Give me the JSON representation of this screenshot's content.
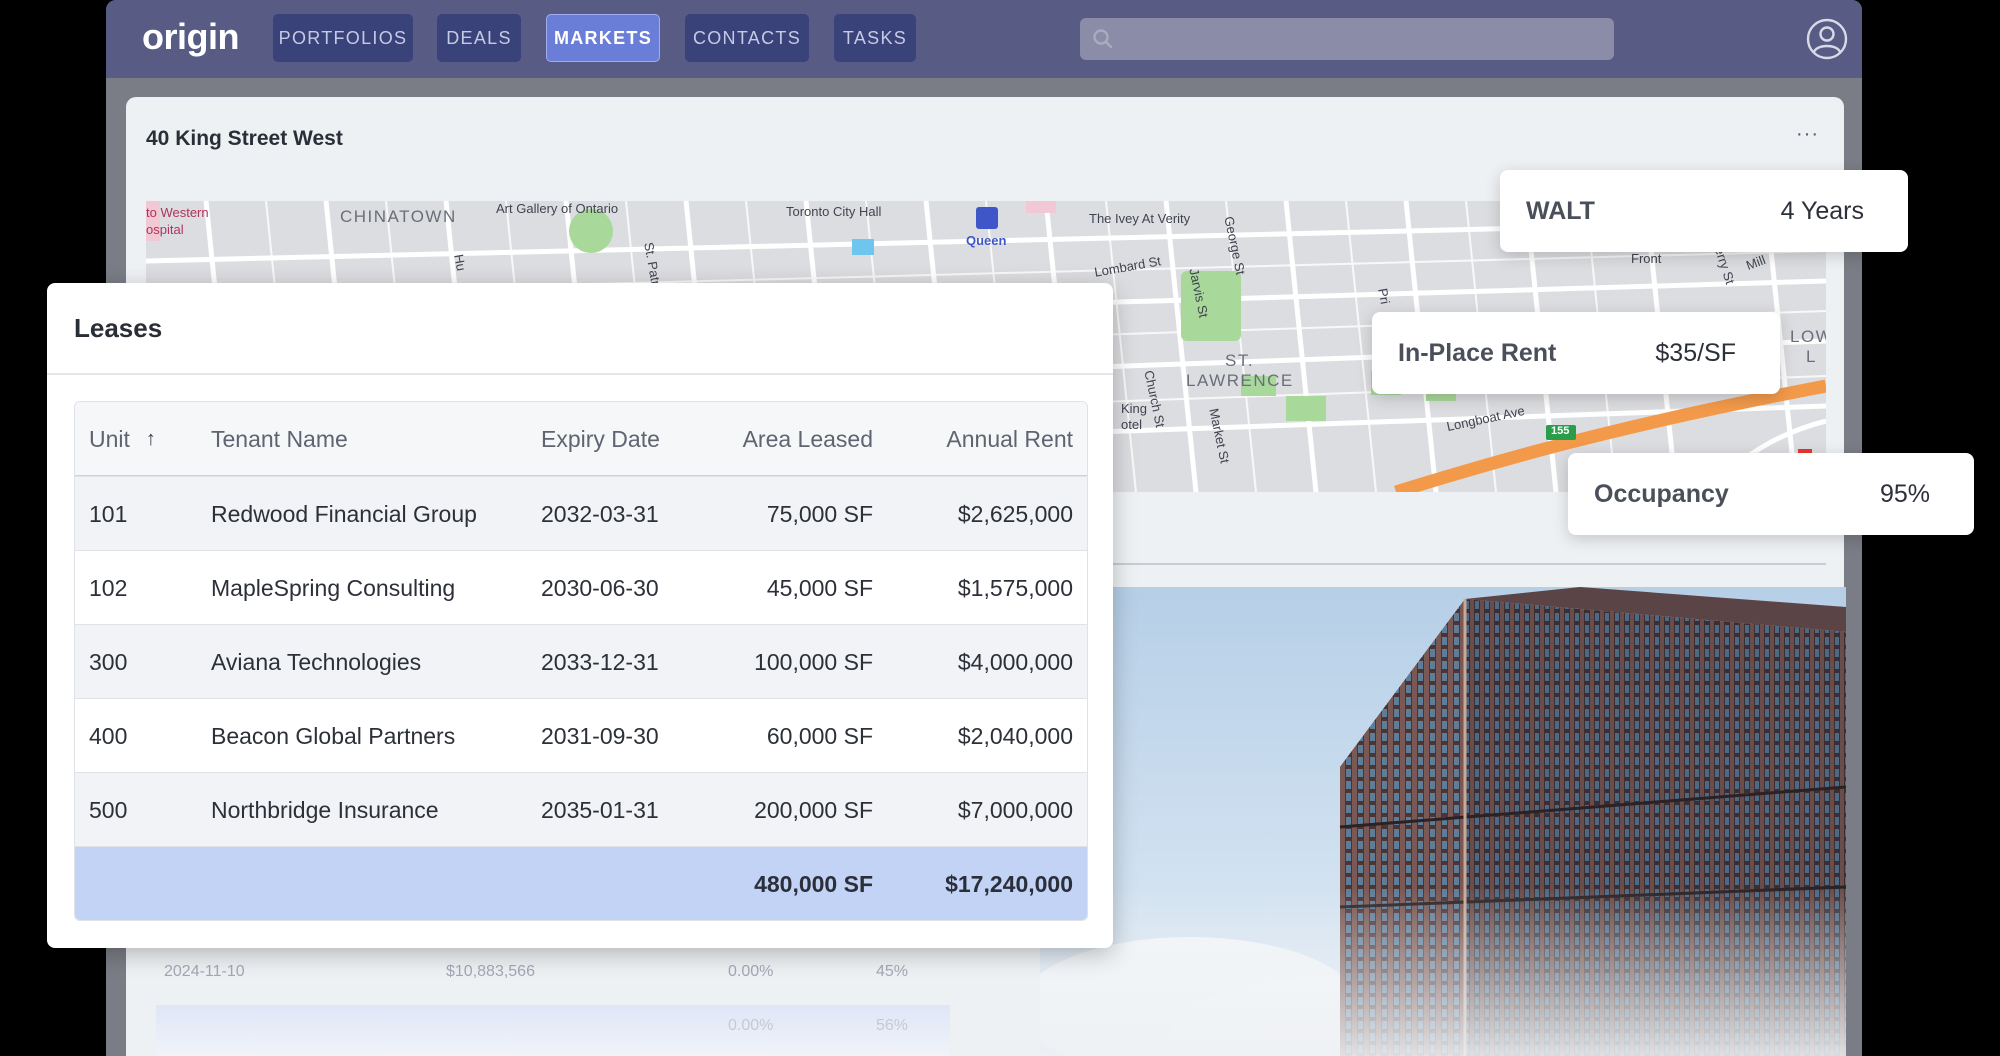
{
  "app": {
    "logo": "origin"
  },
  "nav": [
    {
      "label": "PORTFOLIOS",
      "active": false
    },
    {
      "label": "DEALS",
      "active": false
    },
    {
      "label": "MARKETS",
      "active": true
    },
    {
      "label": "CONTACTS",
      "active": false
    },
    {
      "label": "TASKS",
      "active": false
    }
  ],
  "search": {
    "placeholder": ""
  },
  "property": {
    "title": "40 King Street West",
    "more_label": "···"
  },
  "map": {
    "labels": [
      "to Western",
      "ospital",
      "CHINATOWN",
      "Art Gallery of Ontario",
      "St. Patrick St",
      "Toronto City Hall",
      "Queen",
      "The Ivey At Verity",
      "Lombard St",
      "George St",
      "Jarvis St",
      "ST.",
      "LAWRENCE",
      "Church St",
      "King",
      "otel",
      "Market St",
      "Longboat Ave",
      "155",
      "Front",
      "erry St",
      "Mill",
      "LOW",
      "L",
      "Hu",
      "Pri"
    ]
  },
  "leases": {
    "title": "Leases",
    "columns": [
      "Unit",
      "Tenant Name",
      "Expiry Date",
      "Area Leased",
      "Annual Rent"
    ],
    "sort_icon": "↑",
    "rows": [
      [
        "101",
        "Redwood Financial Group",
        "2032-03-31",
        "75,000 SF",
        "$2,625,000"
      ],
      [
        "102",
        "MapleSpring Consulting",
        "2030-06-30",
        "45,000 SF",
        "$1,575,000"
      ],
      [
        "300",
        "Aviana Technologies",
        "2033-12-31",
        "100,000 SF",
        "$4,000,000"
      ],
      [
        "400",
        "Beacon Global Partners",
        "2031-09-30",
        "60,000 SF",
        "$2,040,000"
      ],
      [
        "500",
        "Northbridge Insurance",
        "2035-01-31",
        "200,000 SF",
        "$7,000,000"
      ]
    ],
    "totals": {
      "area": "480,000 SF",
      "rent": "$17,240,000"
    }
  },
  "metrics": {
    "walt": {
      "label": "WALT",
      "value": "4 Years"
    },
    "rent": {
      "label": "In-Place Rent",
      "value": "$35/SF"
    },
    "occupancy": {
      "label": "Occupancy",
      "value": "95%"
    }
  },
  "background_table": {
    "row1": [
      "2024-11-10",
      "$10,883,566",
      "0.00%",
      "45%"
    ],
    "row2": [
      "0.00%",
      "56%"
    ]
  },
  "colors": {
    "topbar": "#585c85",
    "nav_active": "#6a7ed8",
    "total_row": "#c2d3f5",
    "highway": "#f39a4a"
  }
}
